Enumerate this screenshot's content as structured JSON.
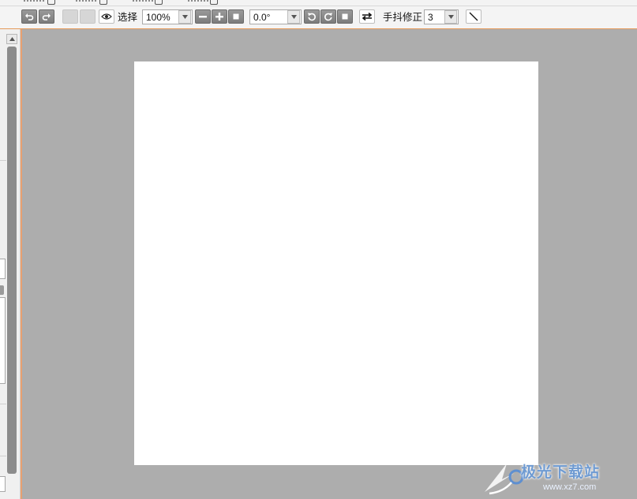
{
  "toolbar": {
    "select_label": "选择",
    "zoom": {
      "value": "100%"
    },
    "rotation": {
      "value": "0.0°"
    },
    "stabilizer": {
      "label": "手抖修正",
      "value": "3"
    }
  },
  "canvas": {
    "background_color": "#adadad",
    "artboard_color": "#ffffff",
    "accent_border_color": "#e59a5a"
  },
  "watermark": {
    "text": "极光下载站",
    "url": "www.xz7.com"
  },
  "icons": {
    "undo": "undo-icon",
    "redo": "redo-icon",
    "eye": "eye-icon",
    "zoom_out": "minus-icon",
    "zoom_in": "plus-icon",
    "zoom_reset": "square-icon",
    "rotate_left": "rotate-left-icon",
    "rotate_right": "rotate-right-icon",
    "rotate_reset": "square-icon",
    "flip": "flip-horizontal-icon",
    "line_tool": "line-icon"
  }
}
